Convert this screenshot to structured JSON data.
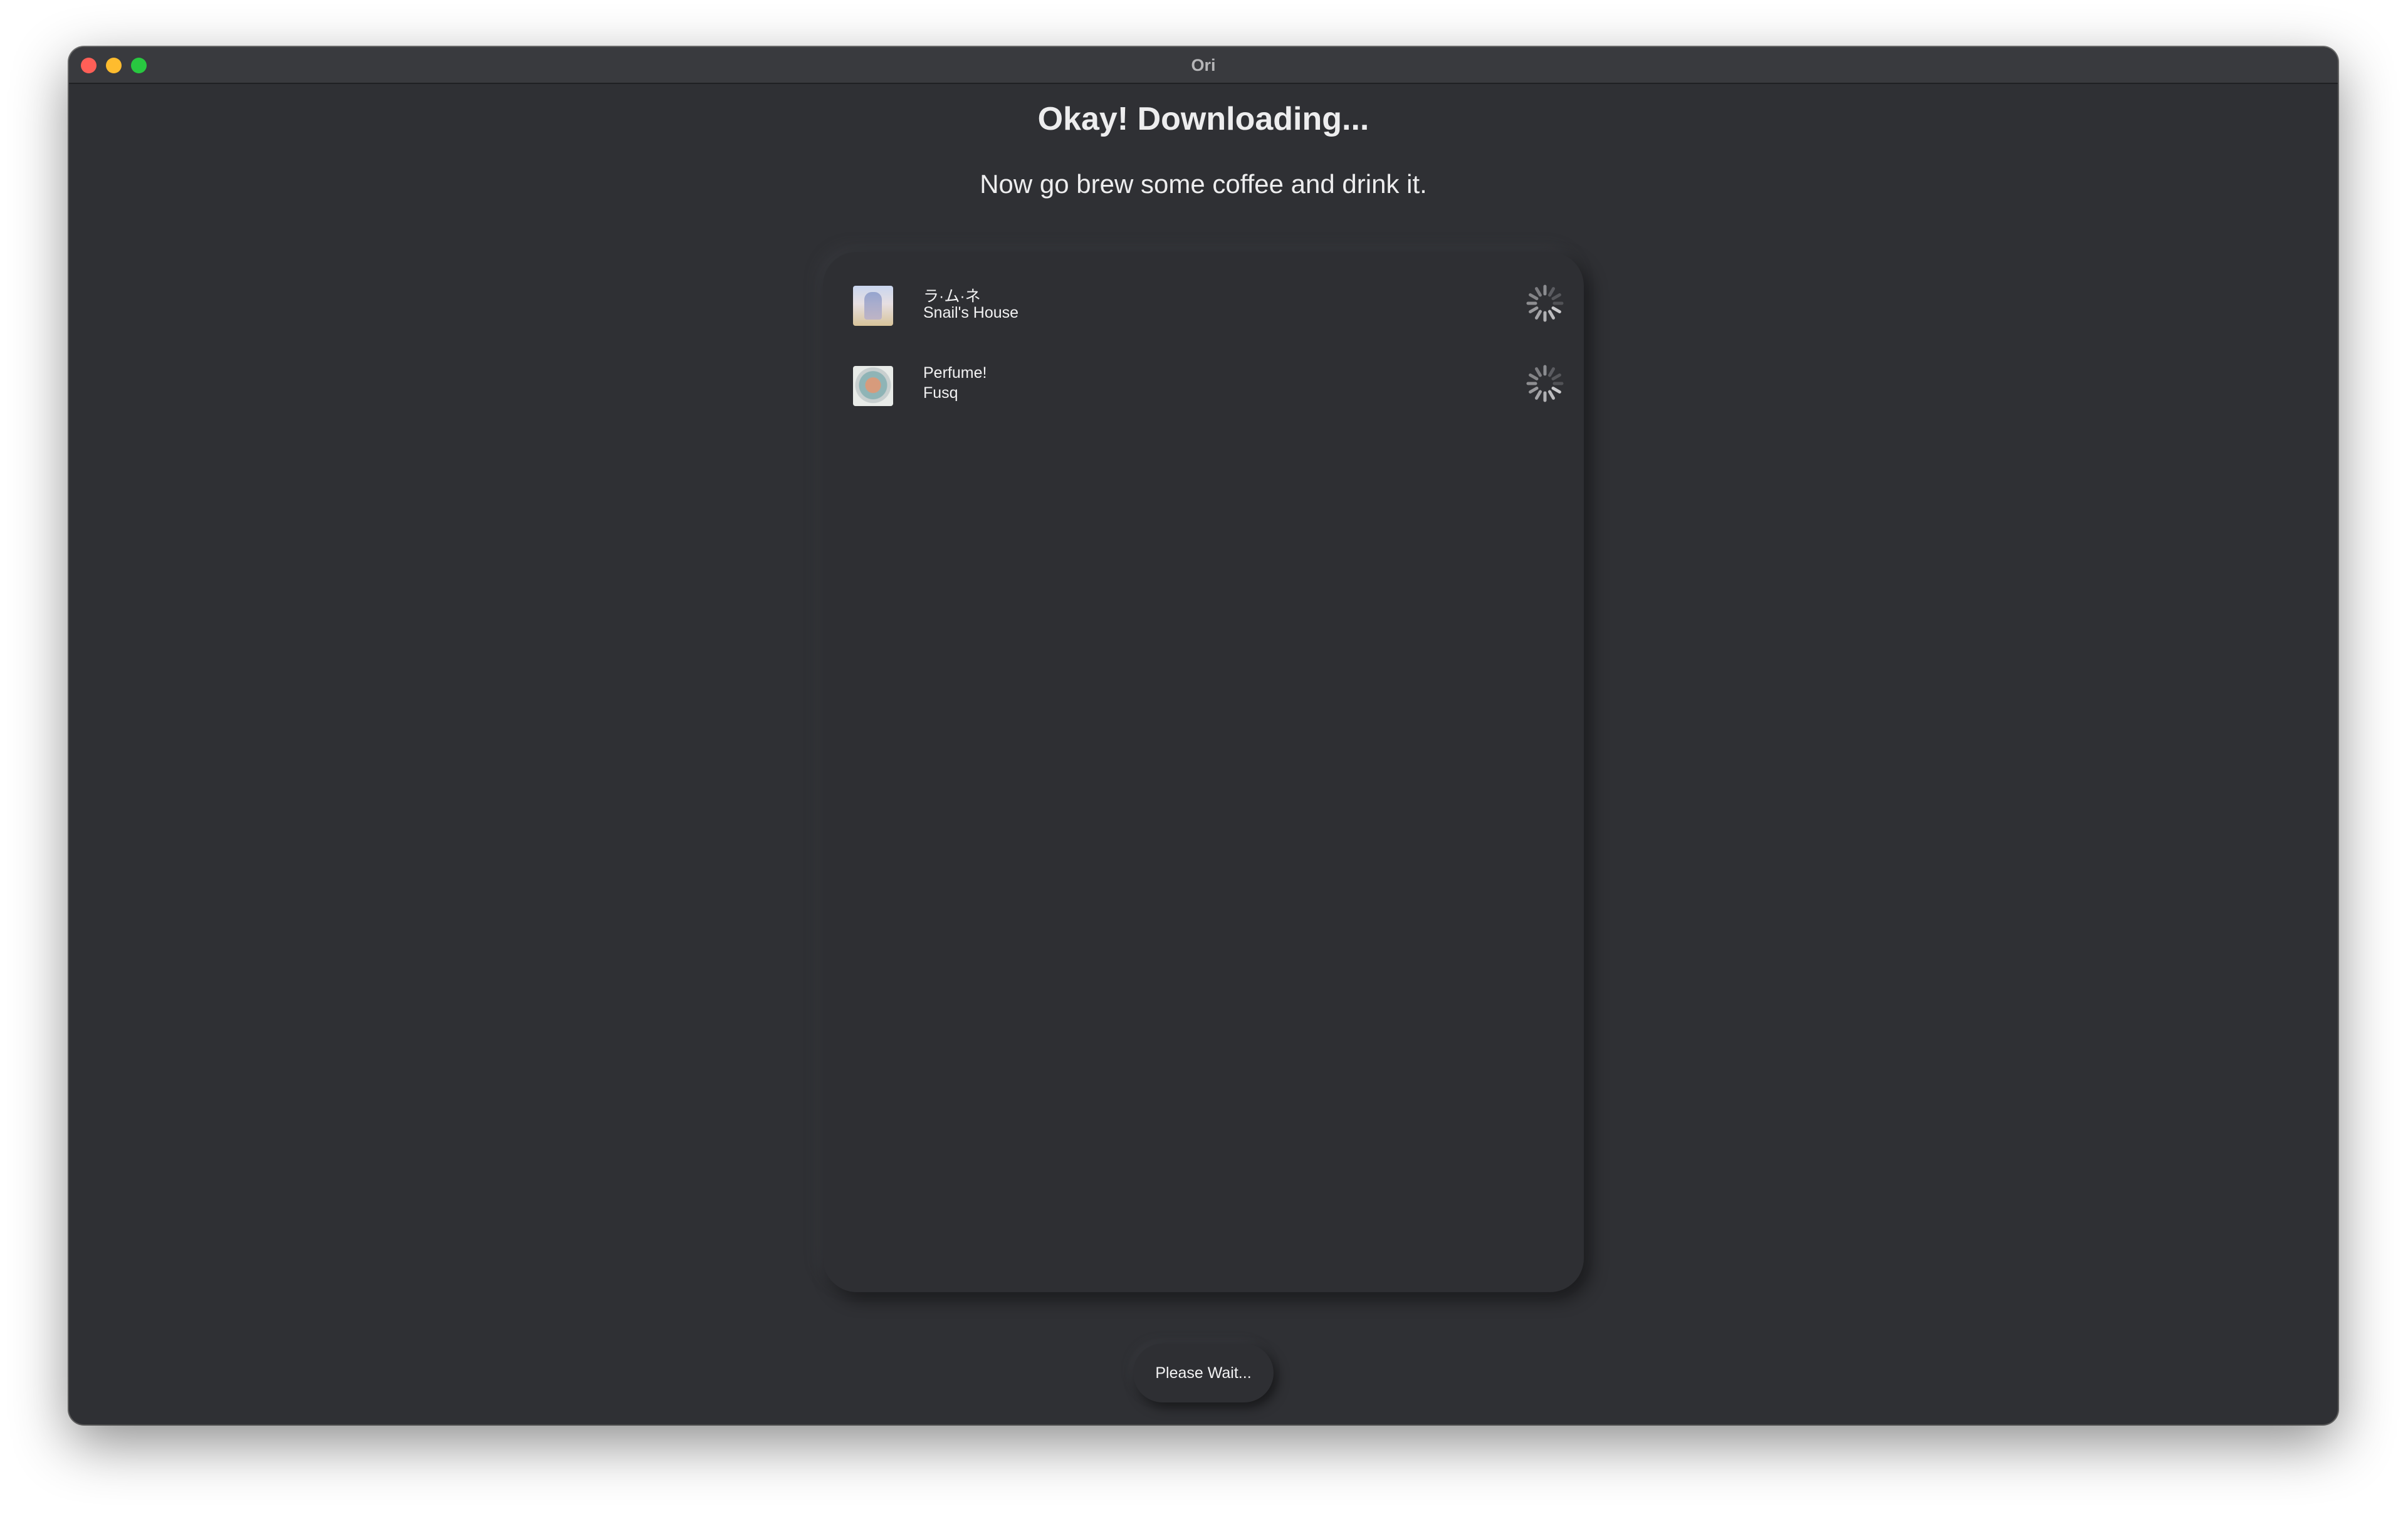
{
  "window": {
    "title": "Ori"
  },
  "header": {
    "title": "Okay! Downloading...",
    "subtitle": "Now go brew some coffee and drink it."
  },
  "downloads": [
    {
      "title": "ラ·ム·ネ",
      "artist": "Snail's House",
      "artwork": "album-art-ramune",
      "status_icon": "loading-spinner-icon"
    },
    {
      "title": "Perfume!",
      "artist": "Fusq",
      "artwork": "album-art-perfume",
      "status_icon": "loading-spinner-icon"
    }
  ],
  "footer": {
    "button_label": "Please Wait..."
  },
  "colors": {
    "background": "#2f3034",
    "titlebar": "#393a3e",
    "text": "#ededee",
    "close": "#ff5f57",
    "minimize": "#febc2e",
    "maximize": "#28c840"
  }
}
